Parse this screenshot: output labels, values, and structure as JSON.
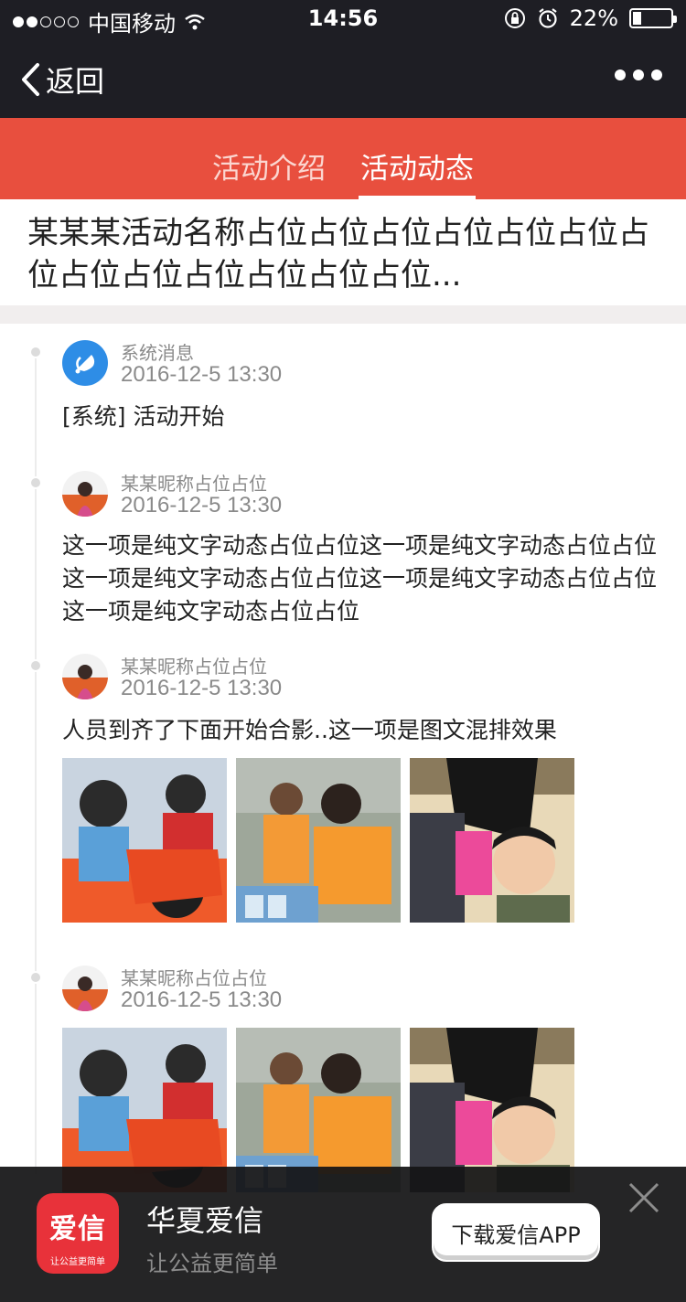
{
  "status_bar": {
    "carrier": "中国移动",
    "time": "14:56",
    "battery": "22%"
  },
  "nav": {
    "back_label": "返回"
  },
  "tabs": [
    {
      "label": "活动介绍",
      "active": false
    },
    {
      "label": "活动动态",
      "active": true
    }
  ],
  "activity": {
    "title": "某某某活动名称占位占位占位占位占位占位占位占位占位占位占位占位占位..."
  },
  "feed": [
    {
      "author": "系统消息",
      "time": "2016-12-5 13:30",
      "text": "[系统] 活动开始"
    },
    {
      "author": "某某昵称占位占位",
      "time": "2016-12-5 13:30",
      "text": "这一项是纯文字动态占位占位这一项是纯文字动态占位占位这一项是纯文字动态占位占位这一项是纯文字动态占位占位这一项是纯文字动态占位占位"
    },
    {
      "author": "某某昵称占位占位",
      "time": "2016-12-5 13:30",
      "text": "人员到齐了下面开始合影..这一项是图文混排效果"
    },
    {
      "author": "某某昵称占位占位",
      "time": "2016-12-5 13:30"
    }
  ],
  "banner": {
    "logo_text": "爱信",
    "logo_subtext": "让公益更简单",
    "app_name": "华夏爱信",
    "slogan": "让公益更简单",
    "download_label": "下载爱信APP"
  },
  "colors": {
    "brand_red": "#e84f3e",
    "dark_bar": "#1e1e24",
    "system_blue": "#2e8de6"
  }
}
